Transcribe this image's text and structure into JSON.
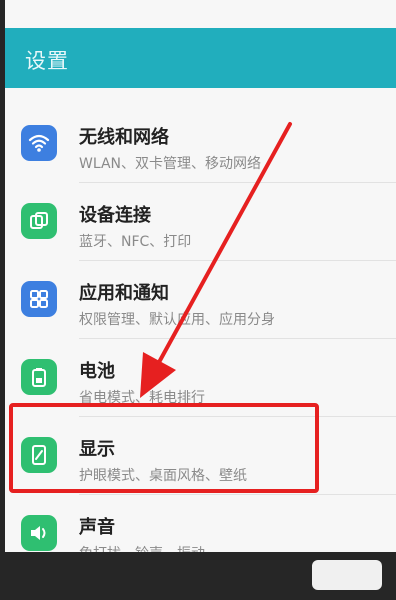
{
  "header": {
    "title": "设置"
  },
  "items": [
    {
      "title": "无线和网络",
      "subtitle": "WLAN、双卡管理、移动网络",
      "icon": "wifi-icon",
      "color": "#3d7fe0"
    },
    {
      "title": "设备连接",
      "subtitle": "蓝牙、NFC、打印",
      "icon": "device-connect-icon",
      "color": "#2fbf71"
    },
    {
      "title": "应用和通知",
      "subtitle": "权限管理、默认应用、应用分身",
      "icon": "apps-grid-icon",
      "color": "#3d7fe0"
    },
    {
      "title": "电池",
      "subtitle": "省电模式、耗电排行",
      "icon": "battery-icon",
      "color": "#2fbf71"
    },
    {
      "title": "显示",
      "subtitle": "护眼模式、桌面风格、壁纸",
      "icon": "display-icon",
      "color": "#2fbf71"
    },
    {
      "title": "声音",
      "subtitle": "免打扰、铃声、振动",
      "icon": "sound-icon",
      "color": "#2fbf71"
    }
  ],
  "annotation": {
    "highlight_color": "#e62020"
  }
}
